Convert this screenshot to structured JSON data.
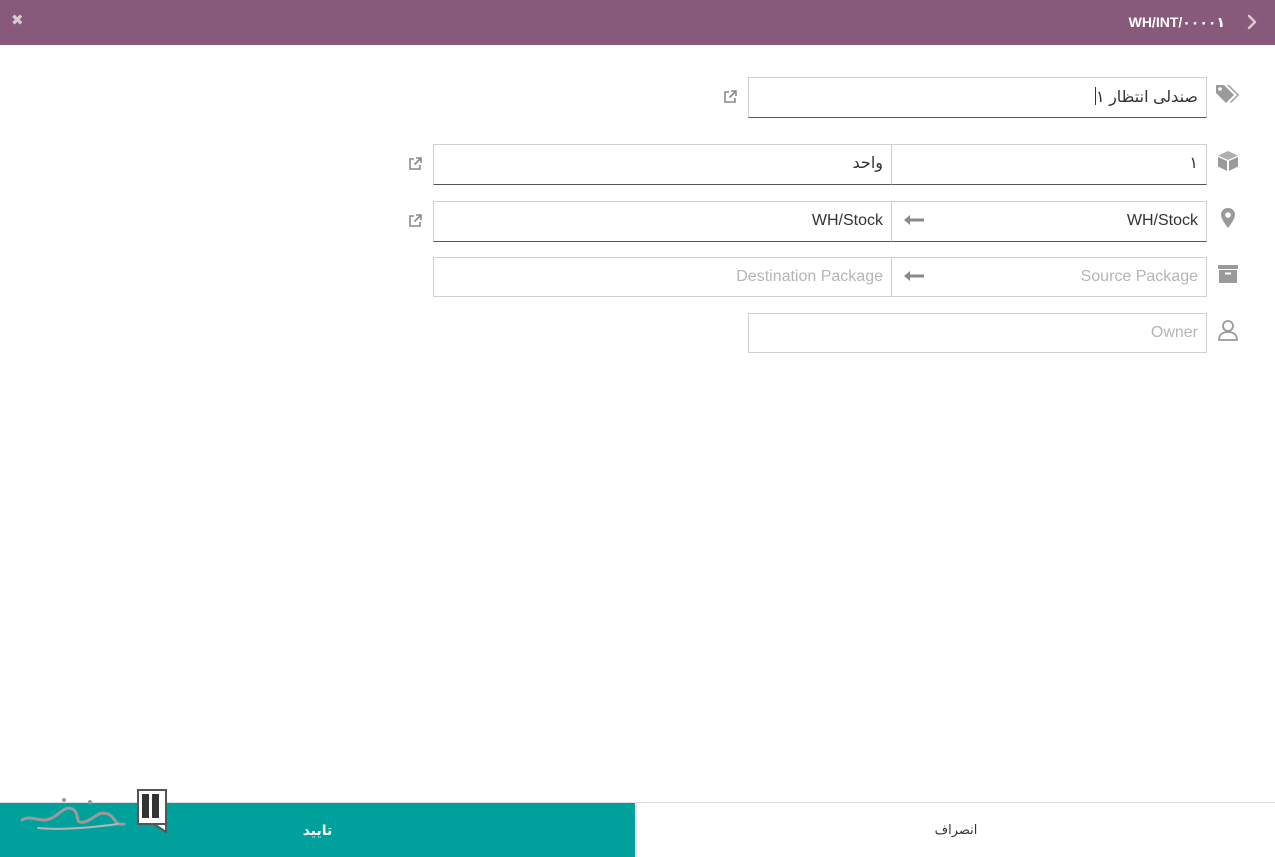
{
  "header": {
    "title": "WH/INT/۰۰۰۰۱",
    "close_icon": "close-icon",
    "back_icon": "chevron-right-icon",
    "background": "#875a7b"
  },
  "form": {
    "product": {
      "value": "صندلی انتظار ۱",
      "icon": "tags-icon"
    },
    "quantity": {
      "value": "۱",
      "uom": "واحد",
      "icon": "cube-icon"
    },
    "location": {
      "source": "WH/Stock",
      "destination": "WH/Stock",
      "icon": "map-marker-icon"
    },
    "package": {
      "source_placeholder": "Source Package",
      "destination_placeholder": "Destination Package",
      "icon": "archive-icon"
    },
    "owner": {
      "placeholder": "Owner",
      "icon": "user-icon"
    }
  },
  "footer": {
    "confirm_label": "تایید",
    "cancel_label": "انصراف",
    "confirm_color": "#00a09d"
  },
  "watermark": {
    "kind": "logo",
    "text": "سبزگستر"
  }
}
